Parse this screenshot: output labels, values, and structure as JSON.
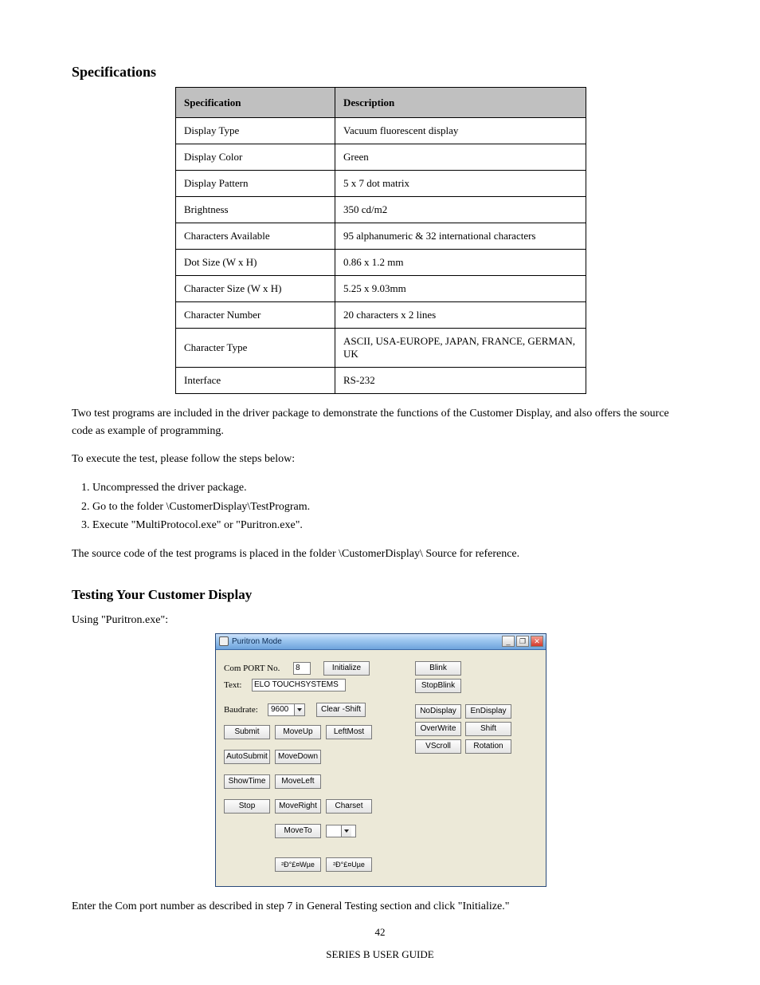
{
  "page_title": "Specifications",
  "table": {
    "headers": [
      "Specification",
      "Description"
    ],
    "rows": [
      [
        "Display Type",
        "Vacuum fluorescent display"
      ],
      [
        "Display Color",
        "Green"
      ],
      [
        "Display Pattern",
        "5 x 7 dot matrix"
      ],
      [
        "Brightness",
        "350 cd/m2"
      ],
      [
        "Characters Available",
        "95 alphanumeric & 32 international characters"
      ],
      [
        "Dot Size (W x H)",
        "0.86 x 1.2 mm"
      ],
      [
        "Character Size (W x H)",
        "5.25 x 9.03mm"
      ],
      [
        "Character Number",
        "20 characters x 2 lines"
      ],
      [
        "Character Type",
        "ASCII, USA-EUROPE, JAPAN, FRANCE, GERMAN, UK"
      ],
      [
        "Interface",
        "RS-232"
      ]
    ]
  },
  "intro_p1": "Two test programs are included in the driver package to demonstrate the functions of the Customer Display, and also offers the source code as example of programming.",
  "intro_p2": "To execute the test, please follow the steps below:",
  "steps": [
    "Uncompressed the driver package.",
    "Go to the folder \\CustomerDisplay\\TestProgram.",
    "Execute \"MultiProtocol.exe\" or \"Puritron.exe\"."
  ],
  "intro_p3": "The source code of the test programs is placed in the folder \\CustomerDisplay\\ Source for reference.",
  "subhead": "Testing Your Customer Display",
  "subsub": "Using \"Puritron.exe\":",
  "puritron": {
    "title": "Puritron Mode",
    "comport_label": "Com PORT No.",
    "comport_value": "8",
    "initialize": "Initialize",
    "text_label": "Text:",
    "text_value": "ELO TOUCHSYSTEMS",
    "baud_label": "Baudrate:",
    "baud_value": "9600",
    "clear_shift": "Clear -Shift",
    "submit": "Submit",
    "moveup": "MoveUp",
    "leftmost": "LeftMost",
    "autosubmit": "AutoSubmit",
    "movedown": "MoveDown",
    "showtime": "ShowTime",
    "moveleft": "MoveLeft",
    "stop": "Stop",
    "moveright": "MoveRight",
    "charset": "Charset",
    "moveto": "MoveTo",
    "garb1": "²Ð°£¤Wµe",
    "garb2": "²Ð°£¤Uµe",
    "blink": "Blink",
    "stopblink": "StopBlink",
    "nodisplay": "NoDisplay",
    "endisplay": "EnDisplay",
    "overwrite": "OverWrite",
    "shift": "Shift",
    "vscroll": "VScroll",
    "rotation": "Rotation"
  },
  "bottom_p": "Enter the Com port number as described in step 7 in General Testing section and click \"Initialize.\"",
  "page_number": "42",
  "footer": "SERIES B USER GUIDE"
}
